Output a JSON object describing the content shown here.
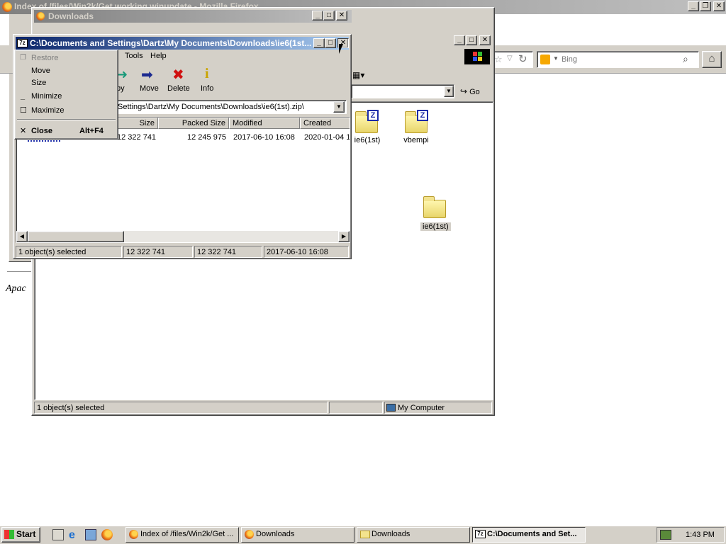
{
  "firefox": {
    "title": "Index of /files/Win2k/Get working winupdate - Mozilla Firefox",
    "search_placeholder": "Bing",
    "page_footer": "Apac"
  },
  "downloads_window": {
    "title": "Downloads",
    "go_label": "Go",
    "icons": [
      {
        "label": "ie6(1st)"
      },
      {
        "label": "vbempi"
      },
      {
        "label": "ie6(1st)"
      }
    ],
    "status": {
      "selected": "1 object(s) selected",
      "zone": "My Computer"
    }
  },
  "sevenzip": {
    "title": "C:\\Documents and Settings\\Dartz\\My Documents\\Downloads\\ie6(1st...",
    "menu": [
      "Tools",
      "Help"
    ],
    "toolbar": [
      {
        "label": "py",
        "icon": "copy-icon"
      },
      {
        "label": "Move",
        "icon": "move-icon"
      },
      {
        "label": "Delete",
        "icon": "delete-icon"
      },
      {
        "label": "Info",
        "icon": "info-icon"
      }
    ],
    "path": "Settings\\Dartz\\My Documents\\Downloads\\ie6(1st).zip\\",
    "columns": [
      "Size",
      "Packed Size",
      "Modified",
      "Created"
    ],
    "rows": [
      {
        "size": "12 322 741",
        "packed": "12 245 975",
        "modified": "2017-06-10 16:08",
        "created": "2020-01-04 1"
      }
    ],
    "status": [
      "1 object(s) selected",
      "12 322 741",
      "12 322 741",
      "2017-06-10 16:08"
    ]
  },
  "system_menu": {
    "items": [
      {
        "label": "Restore",
        "enabled": false
      },
      {
        "label": "Move",
        "enabled": true
      },
      {
        "label": "Size",
        "enabled": true
      },
      {
        "label": "Minimize",
        "enabled": true
      },
      {
        "label": "Maximize",
        "enabled": true
      },
      {
        "label": "Close",
        "enabled": true,
        "shortcut": "Alt+F4"
      }
    ]
  },
  "taskbar": {
    "start": "Start",
    "tasks": [
      {
        "label": "Index of /files/Win2k/Get ..."
      },
      {
        "label": "Downloads"
      },
      {
        "label": "Downloads"
      },
      {
        "label": "C:\\Documents and Set..."
      }
    ],
    "clock": "1:43 PM"
  },
  "colors": {
    "title_active": "#0a246a",
    "title_inactive": "#808080",
    "face": "#d4d0c8"
  }
}
